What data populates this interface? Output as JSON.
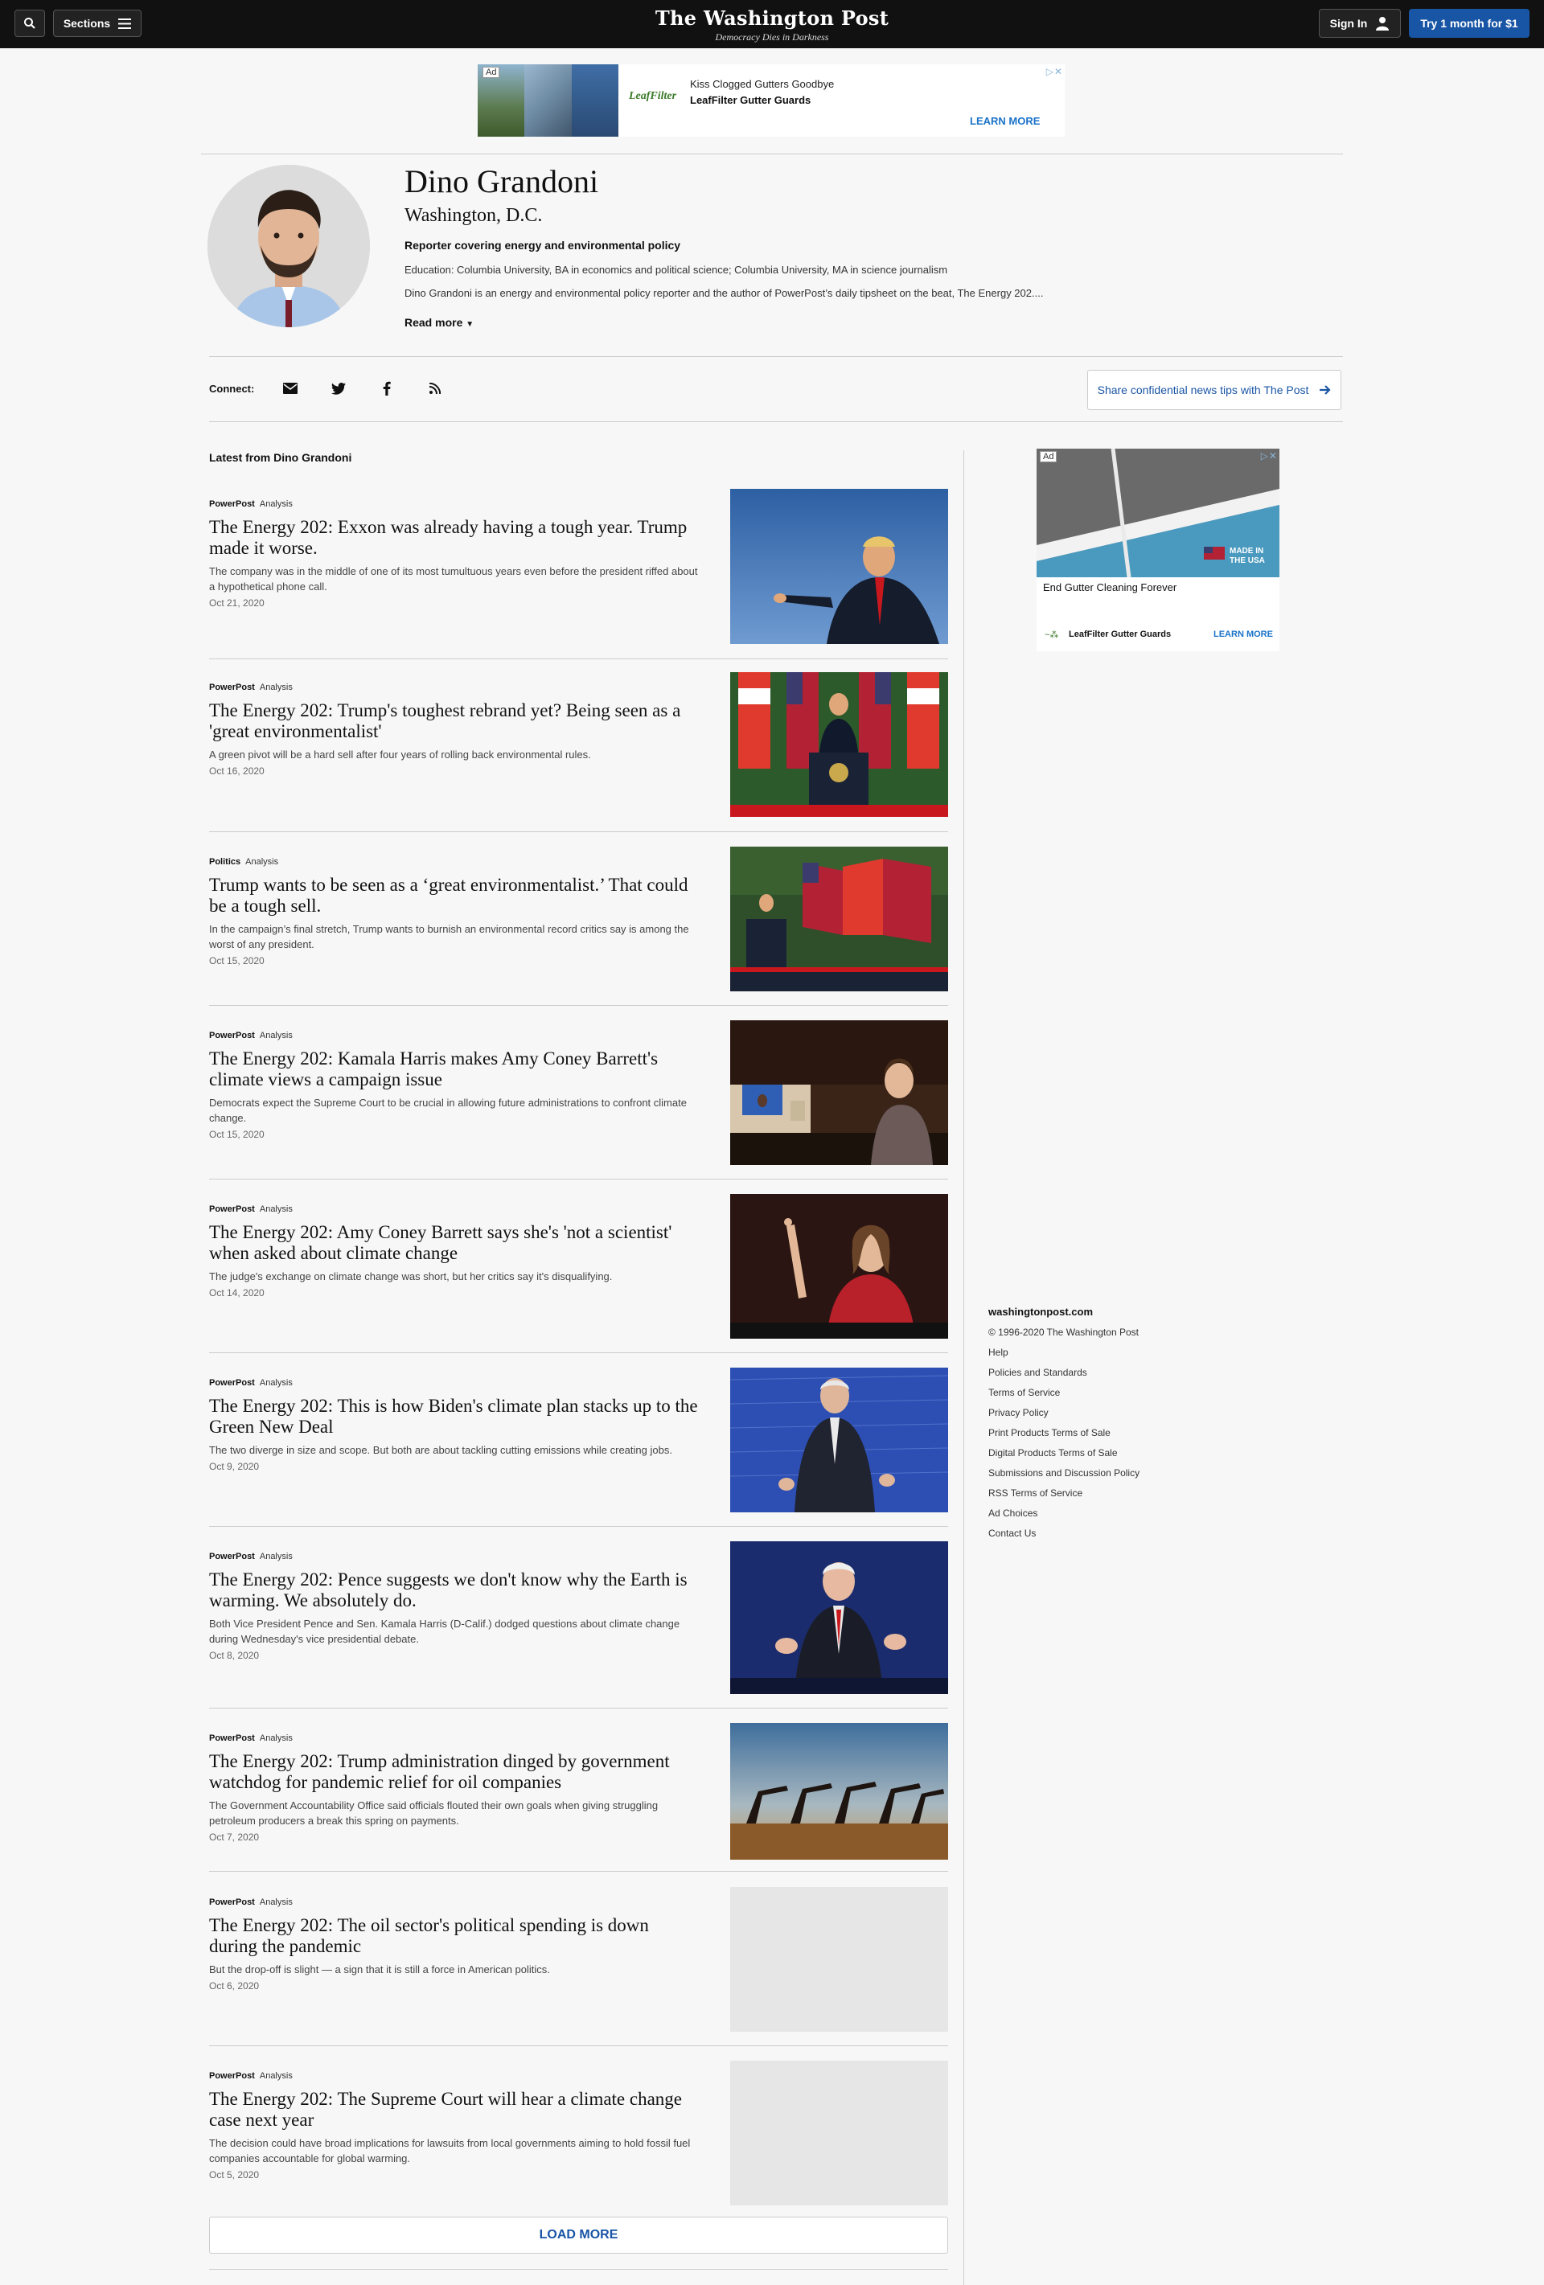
{
  "nav": {
    "sections_label": "Sections",
    "logo": "The Washington Post",
    "tagline": "Democracy Dies in Darkness",
    "signin_label": "Sign In",
    "subscribe_label": "Try 1 month for $1"
  },
  "top_ad": {
    "ad_tag": "Ad",
    "close": "▷✕",
    "brand_logo": "LeafFilter",
    "line1": "Kiss Clogged Gutters Goodbye",
    "line2": "LeafFilter Gutter Guards",
    "cta": "LEARN MORE"
  },
  "profile": {
    "name": "Dino Grandoni",
    "location": "Washington, D.C.",
    "role": "Reporter covering energy and environmental policy",
    "education": "Education: Columbia University, BA in economics and political science; Columbia University, MA in science journalism",
    "bio": "Dino Grandoni is an energy and environmental policy reporter and the author of PowerPost’s daily tipsheet on the beat, The Energy 202....",
    "read_more": "Read more"
  },
  "connect": {
    "label": "Connect:",
    "icons": [
      "email-icon",
      "twitter-icon",
      "facebook-icon",
      "rss-icon"
    ],
    "tips_label": "Share confidential news tips with The Post"
  },
  "latest_title": "Latest from Dino Grandoni",
  "articles": [
    {
      "section": "PowerPost",
      "label": "Analysis",
      "headline": "The Energy 202: Exxon was already having a tough year. Trump made it worse.",
      "blurb": "The company was in the middle of one of its most tumultuous years even before the president riffed about a hypothetical phone call.",
      "date": "Oct 21, 2020"
    },
    {
      "section": "PowerPost",
      "label": "Analysis",
      "headline": "The Energy 202: Trump's toughest rebrand yet? Being seen as a 'great environmentalist'",
      "blurb": "A green pivot will be a hard sell after four years of rolling back environmental rules.",
      "date": "Oct 16, 2020"
    },
    {
      "section": "Politics",
      "label": "Analysis",
      "headline": "Trump wants to be seen as a ‘great environmentalist.’ That could be a tough sell.",
      "blurb": "In the campaign’s final stretch, Trump wants to burnish an environmental record critics say is among the worst of any president.",
      "date": "Oct 15, 2020"
    },
    {
      "section": "PowerPost",
      "label": "Analysis",
      "headline": "The Energy 202: Kamala Harris makes Amy Coney Barrett's climate views a campaign issue",
      "blurb": "Democrats expect the Supreme Court to be crucial in allowing future administrations to confront climate change.",
      "date": "Oct 15, 2020"
    },
    {
      "section": "PowerPost",
      "label": "Analysis",
      "headline": "The Energy 202: Amy Coney Barrett says she's 'not a scientist' when asked about climate change",
      "blurb": "The judge's exchange on climate change was short, but her critics say it's disqualifying.",
      "date": "Oct 14, 2020"
    },
    {
      "section": "PowerPost",
      "label": "Analysis",
      "headline": "The Energy 202: This is how Biden's climate plan stacks up to the Green New Deal",
      "blurb": "The two diverge in size and scope. But both are about tackling cutting emissions while creating jobs.",
      "date": "Oct 9, 2020"
    },
    {
      "section": "PowerPost",
      "label": "Analysis",
      "headline": "The Energy 202: Pence suggests we don't know why the Earth is warming. We absolutely do.",
      "blurb": "Both Vice President Pence and Sen. Kamala Harris (D-Calif.) dodged questions about climate change during Wednesday's vice presidential debate.",
      "date": "Oct 8, 2020"
    },
    {
      "section": "PowerPost",
      "label": "Analysis",
      "headline": "The Energy 202: Trump administration dinged by government watchdog for pandemic relief for oil companies",
      "blurb": "The Government Accountability Office said officials flouted their own goals when giving struggling petroleum producers a break this spring on payments.",
      "date": "Oct 7, 2020"
    },
    {
      "section": "PowerPost",
      "label": "Analysis",
      "headline": "The Energy 202: The oil sector's political spending is down during the pandemic",
      "blurb": "But the drop-off is slight — a sign that it is still a force in American politics.",
      "date": "Oct 6, 2020"
    },
    {
      "section": "PowerPost",
      "label": "Analysis",
      "headline": "The Energy 202: The Supreme Court will hear a climate change case next year",
      "blurb": "The decision could have broad implications for lawsuits from local governments aiming to hold fossil fuel companies accountable for global warming.",
      "date": "Oct 5, 2020"
    }
  ],
  "load_more": "LOAD MORE",
  "right_ad": {
    "ad_tag": "Ad",
    "close": "▷✕",
    "badge": "MADE IN THE USA",
    "text": "End Gutter Cleaning Forever",
    "brand": "LeafFilter Gutter Guards",
    "cta": "LEARN MORE"
  },
  "footer": {
    "site": "washingtonpost.com",
    "items": [
      "© 1996-2020 The Washington Post",
      "Help",
      "Policies and Standards",
      "Terms of Service",
      "Privacy Policy",
      "Print Products Terms of Sale",
      "Digital Products Terms of Sale",
      "Submissions and Discussion Policy",
      "RSS Terms of Service",
      "Ad Choices",
      "Contact Us"
    ]
  }
}
